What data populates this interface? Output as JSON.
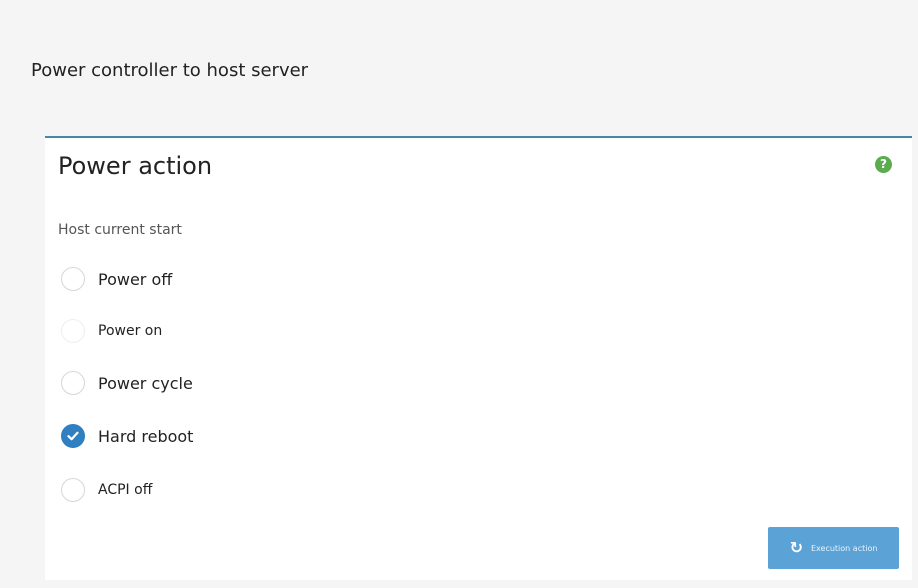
{
  "page": {
    "title": "Power controller to host server"
  },
  "panel": {
    "title": "Power action",
    "help_icon": "question-circle-icon",
    "field_label": "Host current start",
    "options": [
      {
        "label": "Power off",
        "checked": false
      },
      {
        "label": "Power on",
        "checked": false
      },
      {
        "label": "Power cycle",
        "checked": false
      },
      {
        "label": "Hard reboot",
        "checked": true
      },
      {
        "label": "ACPI off",
        "checked": false
      }
    ],
    "execute_button": {
      "label": "Execution action",
      "icon": "refresh-icon"
    }
  },
  "colors": {
    "accent": "#2f7fc1",
    "button": "#5ba3d6",
    "help_icon": "#5cab4f",
    "panel_border": "#4a86a8"
  }
}
